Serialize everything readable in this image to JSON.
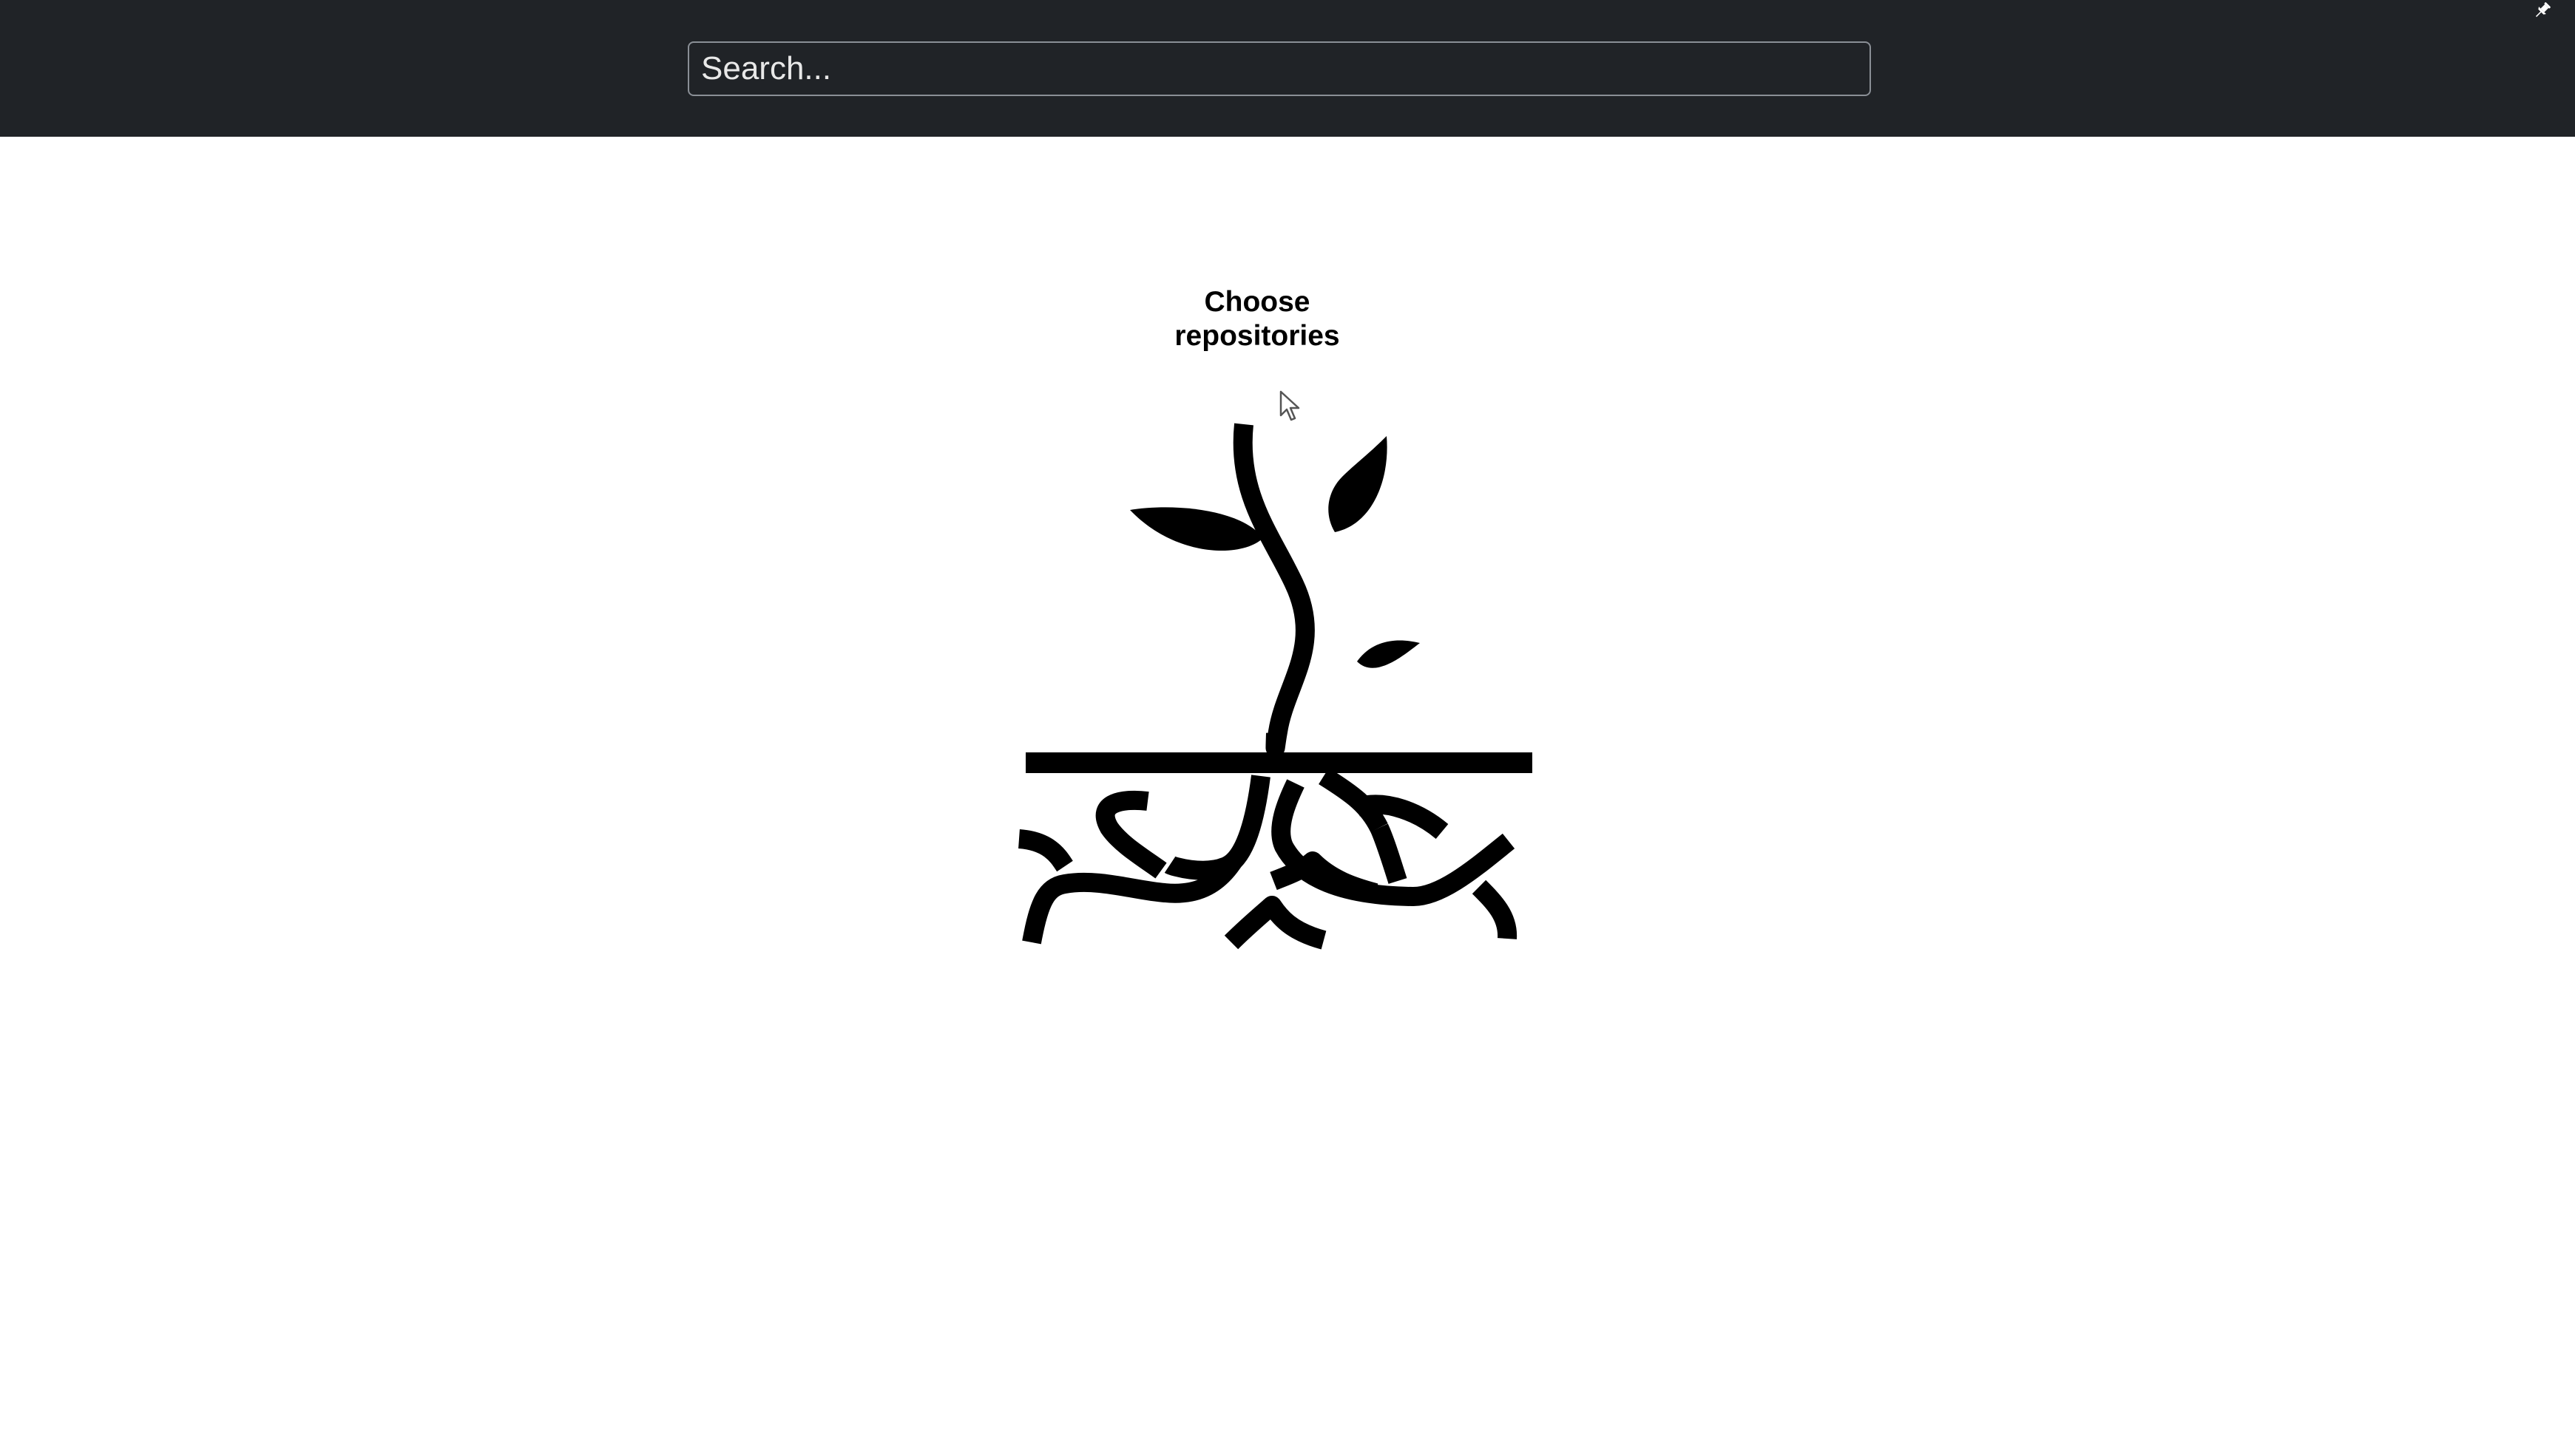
{
  "header": {
    "search": {
      "placeholder": "Search...",
      "value": ""
    },
    "pin_icon": "pin-icon"
  },
  "main": {
    "title_line1": "Choose",
    "title_line2": "repositories",
    "illustration": "plant-with-roots-illustration"
  },
  "colors": {
    "header_bg": "#202327",
    "page_bg": "#ffffff",
    "text": "#000000"
  }
}
